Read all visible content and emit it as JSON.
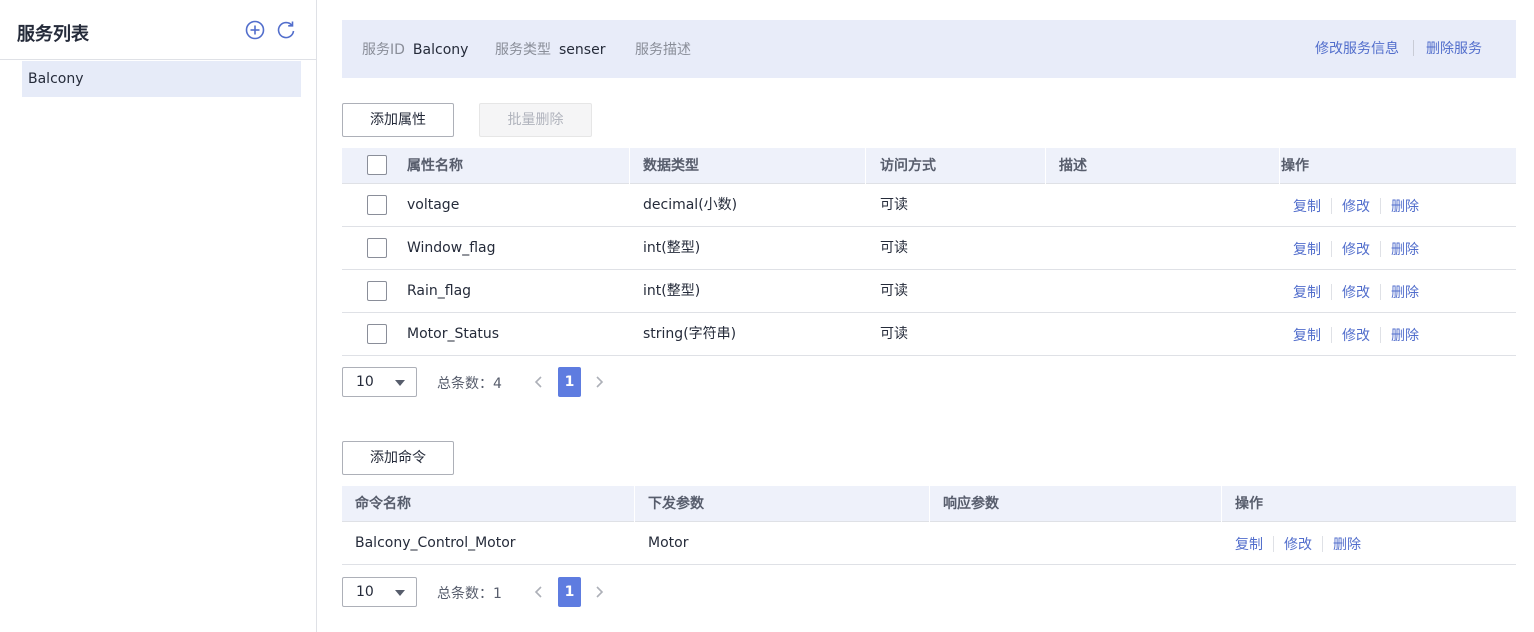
{
  "sidebar": {
    "title": "服务列表",
    "add_icon": "plus-circle-icon",
    "refresh_icon": "refresh-icon",
    "items": [
      {
        "label": "Balcony"
      }
    ]
  },
  "service_info": {
    "id_label": "服务ID",
    "id_value": "Balcony",
    "type_label": "服务类型",
    "type_value": "senser",
    "desc_label": "服务描述",
    "edit_link": "修改服务信息",
    "delete_link": "删除服务"
  },
  "properties": {
    "add_button": "添加属性",
    "batch_delete_button": "批量删除",
    "columns": [
      "属性名称",
      "数据类型",
      "访问方式",
      "描述",
      "操作"
    ],
    "rows": [
      {
        "name": "voltage",
        "type": "decimal(小数)",
        "access": "可读",
        "desc": ""
      },
      {
        "name": "Window_flag",
        "type": "int(整型)",
        "access": "可读",
        "desc": ""
      },
      {
        "name": "Rain_flag",
        "type": "int(整型)",
        "access": "可读",
        "desc": ""
      },
      {
        "name": "Motor_Status",
        "type": "string(字符串)",
        "access": "可读",
        "desc": ""
      }
    ],
    "ops": {
      "copy": "复制",
      "edit": "修改",
      "delete": "删除"
    },
    "pager": {
      "page_size": "10",
      "total": "总条数：4",
      "current_page": "1"
    }
  },
  "commands": {
    "add_button": "添加命令",
    "columns": [
      "命令名称",
      "下发参数",
      "响应参数",
      "操作"
    ],
    "rows": [
      {
        "name": "Balcony_Control_Motor",
        "send_params": "Motor",
        "resp_params": ""
      }
    ],
    "ops": {
      "copy": "复制",
      "edit": "修改",
      "delete": "删除"
    },
    "pager": {
      "page_size": "10",
      "total": "总条数：1",
      "current_page": "1"
    }
  },
  "colors": {
    "accent": "#5e7ce0",
    "link": "#526ecc",
    "header_bg": "#eef1fa",
    "info_bg": "#e8ecf9",
    "selected_bg": "#e6ebf8"
  }
}
